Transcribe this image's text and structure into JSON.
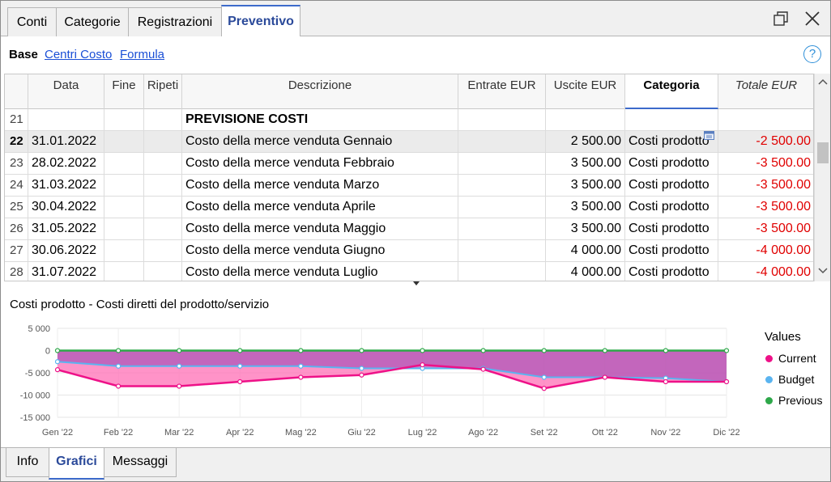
{
  "tabs": [
    {
      "label": "Conti"
    },
    {
      "label": "Categorie"
    },
    {
      "label": "Registrazioni"
    },
    {
      "label": "Preventivo"
    }
  ],
  "subtabs": {
    "base": "Base",
    "centri": "Centri Costo",
    "formula": "Formula"
  },
  "help_symbol": "?",
  "columns": {
    "data": "Data",
    "fine": "Fine",
    "ripeti": "Ripeti",
    "descrizione": "Descrizione",
    "entrate": "Entrate EUR",
    "uscite": "Uscite EUR",
    "categoria": "Categoria",
    "totale": "Totale EUR"
  },
  "rows": [
    {
      "n": "21",
      "data": "",
      "desc": "PREVISIONE COSTI",
      "uscite": "",
      "cat": "",
      "tot": ""
    },
    {
      "n": "22",
      "data": "31.01.2022",
      "desc": "Costo della merce venduta Gennaio",
      "uscite": "2 500.00",
      "cat": "Costi prodotto",
      "tot": "-2 500.00"
    },
    {
      "n": "23",
      "data": "28.02.2022",
      "desc": "Costo della merce venduta Febbraio",
      "uscite": "3 500.00",
      "cat": "Costi prodotto",
      "tot": "-3 500.00"
    },
    {
      "n": "24",
      "data": "31.03.2022",
      "desc": "Costo della merce venduta Marzo",
      "uscite": "3 500.00",
      "cat": "Costi prodotto",
      "tot": "-3 500.00"
    },
    {
      "n": "25",
      "data": "30.04.2022",
      "desc": "Costo della merce venduta Aprile",
      "uscite": "3 500.00",
      "cat": "Costi prodotto",
      "tot": "-3 500.00"
    },
    {
      "n": "26",
      "data": "31.05.2022",
      "desc": "Costo della merce venduta Maggio",
      "uscite": "3 500.00",
      "cat": "Costi prodotto",
      "tot": "-3 500.00"
    },
    {
      "n": "27",
      "data": "30.06.2022",
      "desc": "Costo della merce venduta Giugno",
      "uscite": "4 000.00",
      "cat": "Costi prodotto",
      "tot": "-4 000.00"
    },
    {
      "n": "28",
      "data": "31.07.2022",
      "desc": "Costo della merce venduta Luglio",
      "uscite": "4 000.00",
      "cat": "Costi prodotto",
      "tot": "-4 000.00"
    }
  ],
  "bottom_tabs": [
    {
      "label": "Info"
    },
    {
      "label": "Grafici"
    },
    {
      "label": "Messaggi"
    }
  ],
  "chart_data": {
    "type": "area",
    "title": "Costi prodotto - Costi diretti del prodotto/servizio",
    "categories": [
      "Gen '22",
      "Feb '22",
      "Mar '22",
      "Apr '22",
      "Mag '22",
      "Giu '22",
      "Lug '22",
      "Ago '22",
      "Set '22",
      "Ott '22",
      "Nov '22",
      "Dic '22"
    ],
    "y_ticks": [
      "5 000",
      "0",
      "-5 000",
      "-10 000",
      "-15 000"
    ],
    "ylim": [
      -15000,
      5000
    ],
    "legend_title": "Values",
    "legend_position": "right",
    "series": [
      {
        "name": "Current",
        "color": "#ee1188",
        "values": [
          -4300,
          -8000,
          -8000,
          -7000,
          -6000,
          -5500,
          -3200,
          -4200,
          -8500,
          -6000,
          -7000,
          -7000
        ]
      },
      {
        "name": "Budget",
        "color": "#5ab4f0",
        "values": [
          -2500,
          -3500,
          -3500,
          -3500,
          -3500,
          -4000,
          -4000,
          -4000,
          -6000,
          -6000,
          -6200,
          -7000
        ]
      },
      {
        "name": "Previous",
        "color": "#2ea84a",
        "values": [
          0,
          0,
          0,
          0,
          0,
          0,
          0,
          0,
          0,
          0,
          0,
          0
        ]
      }
    ],
    "grid": true
  },
  "colors": {
    "accent": "#3c6acb",
    "negative": "#e00000",
    "link": "#1a4fd6"
  }
}
